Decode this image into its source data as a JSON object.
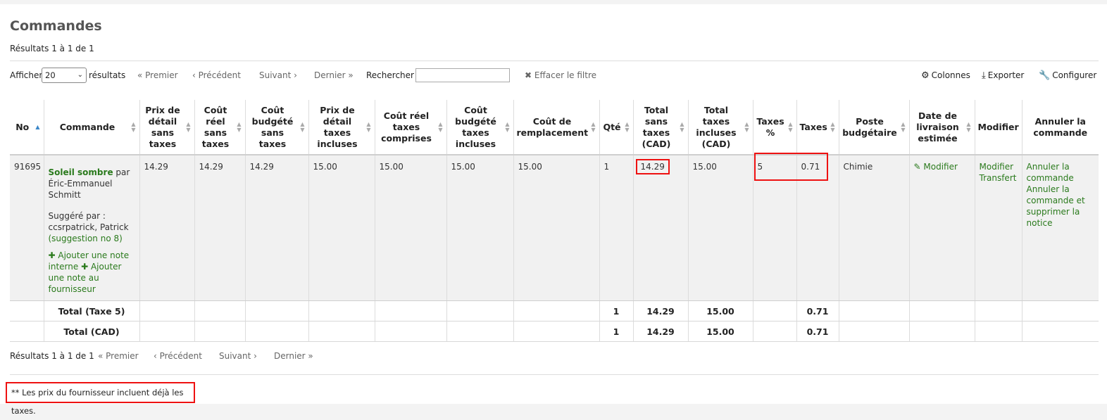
{
  "page": {
    "title": "Commandes",
    "results_summary": "Résultats 1 à 1 de 1"
  },
  "toolbar": {
    "show_label": "Afficher",
    "page_size": "20",
    "results_label": "résultats",
    "first": "« Premier",
    "previous": "‹ Précédent",
    "next": "Suivant ›",
    "last": "Dernier »",
    "search_label": "Rechercher :",
    "search_value": "",
    "clear_filter": "Effacer le filtre",
    "columns": "Colonnes",
    "export": "Exporter",
    "configure": "Configurer"
  },
  "table": {
    "headers": [
      "No",
      "Commande",
      "Prix de détail sans taxes",
      "Coût réel sans taxes",
      "Coût budgété sans taxes",
      "Prix de détail taxes incluses",
      "Coût réel taxes comprises",
      "Coût budgété taxes incluses",
      "Coût de remplacement",
      "Qté",
      "Total sans taxes (CAD)",
      "Total taxes incluses (CAD)",
      "Taxes %",
      "Taxes",
      "Poste budgétaire",
      "Date de livraison estimée",
      "Modifier",
      "Annuler la commande"
    ],
    "row": {
      "number": "91695",
      "order_title": "Soleil sombre",
      "order_by": "par",
      "order_author": "Éric-Emmanuel Schmitt",
      "suggested_by_label": "Suggéré par :",
      "suggested_by": "ccsrpatrick, Patrick",
      "suggestion_link": "(suggestion no 8)",
      "add_internal_note": "Ajouter une note interne",
      "add_vendor_note": "Ajouter une note au fournisseur",
      "retail_excl": "14.29",
      "actual_excl": "14.29",
      "budget_excl": "14.29",
      "retail_incl": "15.00",
      "actual_incl": "15.00",
      "budget_incl": "15.00",
      "replacement": "15.00",
      "qty": "1",
      "total_excl": "14.29",
      "total_incl": "15.00",
      "tax_rate": "5",
      "tax": "0.71",
      "fund": "Chimie",
      "eta_modify": "Modifier",
      "modify": "Modifier",
      "transfer": "Transfert",
      "cancel_order": "Annuler la commande",
      "cancel_order_delete": "Annuler la commande et supprimer la notice"
    },
    "totals": [
      {
        "label": "Total (Taxe 5)",
        "qty": "1",
        "total_excl": "14.29",
        "total_incl": "15.00",
        "tax": "0.71"
      },
      {
        "label": "Total (CAD)",
        "qty": "1",
        "total_excl": "14.29",
        "total_incl": "15.00",
        "tax": "0.71"
      }
    ]
  },
  "footer": {
    "results_summary": "Résultats 1 à 1 de 1",
    "first": "« Premier",
    "previous": "‹ Précédent",
    "next": "Suivant ›",
    "last": "Dernier »",
    "footnote": "** Les prix du fournisseur incluent déjà les taxes."
  },
  "colors": {
    "link": "#2a7a1c",
    "highlight": "#e11111",
    "sort_active": "#3a86c8"
  }
}
